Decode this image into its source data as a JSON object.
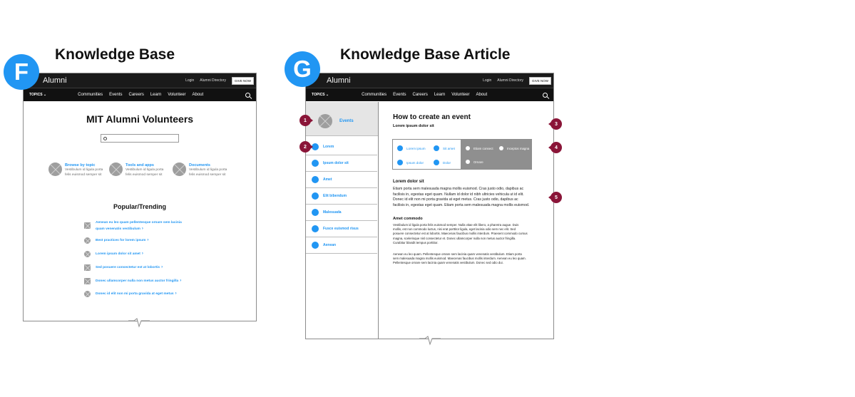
{
  "panel_f": {
    "badge": "F",
    "heading": "Knowledge Base",
    "brand": "Alumni",
    "top_links": [
      "Login",
      "Alumni Directory"
    ],
    "give_button": "GIVE NOW",
    "topics_label": "TOPICS",
    "nav": [
      "Communities",
      "Events",
      "Careers",
      "Learn",
      "Volunteer",
      "About"
    ],
    "page_title": "MIT Alumni Volunteers",
    "search_placeholder": "",
    "features": [
      {
        "title": "Browse by topic",
        "desc1": "Vestibulum id ligula porta",
        "desc2": "felis euismod semper sit"
      },
      {
        "title": "Tools and apps",
        "desc1": "Vestibulum id ligula porta",
        "desc2": "felis euismod semper sit"
      },
      {
        "title": "Documents",
        "desc1": "Vestibulum id ligula porta",
        "desc2": "felis euismod semper sit"
      }
    ],
    "popular_title": "Popular/Trending",
    "trending": [
      {
        "line1": "Aenean eu leo quam pellentesque ornare sem lacinia",
        "line2": "quam venenatis vestibulum",
        "shape": "square"
      },
      {
        "line1": "Best practices for lorem ipsum",
        "line2": "",
        "shape": "circle"
      },
      {
        "line1": "Lorem ipsum dolor sit amet",
        "line2": "",
        "shape": "circle"
      },
      {
        "line1": "Sed posuere consectetur est at lobortis",
        "line2": "",
        "shape": "square"
      },
      {
        "line1": "Donec ullamcorper nulla non metus auctor fringilla",
        "line2": "",
        "shape": "square"
      },
      {
        "line1": "Donec id elit non mi porta gravida at eget metus",
        "line2": "",
        "shape": "circle"
      }
    ]
  },
  "panel_g": {
    "badge": "G",
    "heading": "Knowledge Base Article",
    "brand": "Alumni",
    "top_links": [
      "Login",
      "Alumni Directory"
    ],
    "give_button": "GIVE NOW",
    "topics_label": "TOPICS",
    "nav": [
      "Communities",
      "Events",
      "Careers",
      "Learn",
      "Volunteer",
      "About"
    ],
    "sidebar_header": "Events",
    "sidebar_items": [
      "Lorem",
      "Ipsum dolor sit",
      "Amet",
      "Elit bibendum",
      "Malesuada",
      "Fusce euismod risus",
      "Aenean"
    ],
    "article_title": "How to create an event",
    "article_subtitle": "Lorem ipsum dolor sit",
    "jump_links": [
      "Lorem ipsum",
      "Sit amet",
      "Ipsum dolor",
      "Dolor"
    ],
    "jump_links_grey": [
      "Etiam consect",
      "Inceptos magna",
      "Ornare"
    ],
    "section1_title": "Lorem dolor sit",
    "section1_lines": [
      "Etiam porta sem malesuada magna mollis euismod. Cras justo odio, dapibus ac",
      "facilisis in, egestas eget quam. Nullam id dolor id nibh ultricies vehicula ut id elit.",
      "Donec id elit non mi porta gravida at eget metus. Cras justo odio, dapibus ac",
      "facilisis in, egestas eget quam. Etiam porta sem malesuada magna mollis euismod."
    ],
    "section2_title": "Amet commodo",
    "section2_lines": [
      "Vestibulum id ligula porta felis euismod semper. Nulla vitae elit libero, a pharetra augue. Duis",
      "mollis, est non commodo luctus, nisi erat porttitor ligula, eget lacinia odio sem nec elit. Sed",
      "posuere consectetur est at lobortis. Maecenas faucibus mollis interdum. Praesent commodo cursus",
      "magna, scelerisque nisl consectetur et. Donec ullamcorper nulla non metus auctor fringilla.",
      "Curabitur blandit tempus porttitor."
    ],
    "section3_lines": [
      "Aenean eu leo quam. Pellentesque ornare sem lacinia quam venenatis vestibulum. Etiam porta",
      "sem malesuada magna mollis euismod. Maecenas faucibus mollis interdum. Aenean eu leo quam.",
      "Pellentesque ornare sem lacinia quam venenatis vestibulum. Donec sed odio dui."
    ],
    "callouts": [
      "1",
      "2",
      "3",
      "4",
      "5"
    ]
  },
  "colors": {
    "accent_blue": "#2196f3",
    "callout_maroon": "#8a1538",
    "nav_dark": "#111111",
    "panel_grey": "#8f8f8f"
  }
}
